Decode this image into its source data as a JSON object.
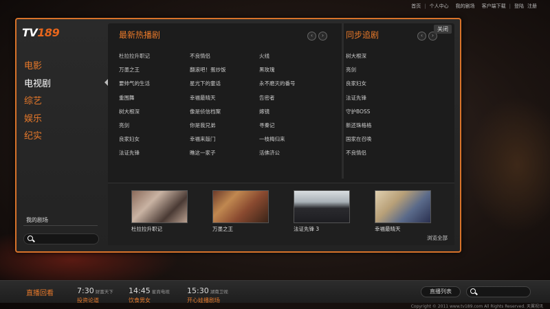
{
  "topnav": {
    "home": "首页",
    "personal": "个人中心",
    "my_shows": "我的剧场",
    "client_download": "客户端下载",
    "login": "登陆",
    "register": "注册"
  },
  "logo": {
    "tv": "TV",
    "num": "189"
  },
  "categories": [
    "电影",
    "电视剧",
    "综艺",
    "娱乐",
    "纪实"
  ],
  "left": {
    "my_shows": "我的剧场"
  },
  "hot": {
    "title": "最新热播剧",
    "col1": [
      "杜拉拉升职记",
      "万墨之王",
      "要帅气的生活",
      "重围舞",
      "树大根深",
      "亮剑",
      "良家妇女",
      "法证先锋"
    ],
    "col2": [
      "不良情侣",
      "翻滚吧！蛋炒饭",
      "星光下的童话",
      "幸福最晴天",
      "像是侦信档案",
      "你是我兄弟",
      "幸福来敲门",
      "瞧这一家子"
    ],
    "col3": [
      "火线",
      "黑玫瑰",
      "永不磨灭的番号",
      "告密者",
      "嫁镜",
      "寻秦记",
      "一枝梅归来",
      "活佛济公"
    ]
  },
  "sync": {
    "title": "同步追剧",
    "items": [
      "树大根深",
      "亮剑",
      "良家妇女",
      "法证先锋",
      "守护BOSS",
      "新还珠格格",
      "国家在召唤",
      "不良情侣"
    ]
  },
  "close": "关闭",
  "thumbs": [
    "杜拉拉升职记",
    "万墨之王",
    "法证先锋 3",
    "幸福最晴天"
  ],
  "view_all": "浏览全部",
  "bottom": {
    "live_label": "直播回看",
    "schedule": [
      {
        "time": "7:30",
        "channel": "财富天下",
        "program": "投资论道"
      },
      {
        "time": "14:45",
        "channel": "星尚电视",
        "program": "饮食男女"
      },
      {
        "time": "15:30",
        "channel": "湖南卫视",
        "program": "开心娃播剧场"
      }
    ],
    "list_button": "直播列表"
  },
  "copyright": "Copyright © 2011 www.tv189.com All Rights Reserved. 天翼视讯",
  "colors": {
    "accent": "#e8792a",
    "panel_border": "#d9732a"
  }
}
